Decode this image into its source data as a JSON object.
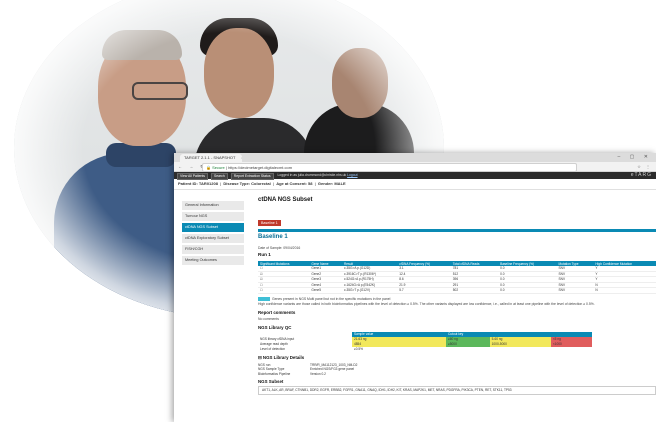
{
  "browser": {
    "tab_title": "TARGET 2.1.1 - SNAPSHOT",
    "tab_close": "×",
    "window_controls": "– ▢ ✕",
    "nav": "← → ↻",
    "secure_label": "Secure",
    "url": "https://decimetarget.digitalecmt.com",
    "right_icons": "☆ ⋮"
  },
  "app_toolbar": {
    "buttons": [
      "View All Patients",
      "Search",
      "Report Extraction Status"
    ],
    "logged_in_text": "Logged in as",
    "user_email": "julia.drummond@christie.nhs.uk",
    "logout": "Logout",
    "brand": "eTARG"
  },
  "patient": {
    "id_label": "Patient ID: TAR01208",
    "disease": "Disease Type: Colorectal",
    "age": "Age at Consent: 58",
    "gender": "Gender: MALE"
  },
  "sidebar": {
    "items": [
      {
        "label": "General Information"
      },
      {
        "label": "Tumour NGS"
      },
      {
        "label": "ctDNA NGS Subset"
      },
      {
        "label": "ctDNA Exploratory Subset"
      },
      {
        "label": "FISH/CGH"
      },
      {
        "label": "Meeting Outcomes"
      }
    ]
  },
  "main": {
    "title": "ctDNA NGS Subset",
    "baseline_badge": "Baseline 1",
    "baseline_heading": "Baseline 1",
    "date_of_sample": "Date of Sample: 09/04/2016",
    "run": "Run 1",
    "mutation_table": {
      "headers": [
        "Significant Mutations",
        "Gene Name",
        "Result",
        "cfDNA Frequency (%)",
        "Total cfDNA Reads",
        "Baseline Frequency (%)",
        "Mutation Type",
        "High Confidence Mutation"
      ],
      "rows": [
        [
          "☐",
          "Gene1",
          "c.35G>A p.(G12D)",
          "3.1",
          "781",
          "0.0",
          "SNV",
          "Y"
        ],
        [
          "☑",
          "Gene2",
          "c.3916C>T p.(R1306*)",
          "12.4",
          "512",
          "0.0",
          "SNV",
          "Y"
        ],
        [
          "☑",
          "Gene3",
          "c.524G>A p.(R175H)",
          "8.6",
          "396",
          "0.0",
          "SNV",
          "Y"
        ],
        [
          "☐",
          "Gene4",
          "c.1624G>A p.(E542K)",
          "21.9",
          "291",
          "0.0",
          "SNV",
          "N"
        ],
        [
          "☐",
          "Gene5",
          "c.35G>T p.(G12V)",
          "5.7",
          "502",
          "0.0",
          "SNV",
          "N"
        ]
      ]
    },
    "legend_text": "Genes present in NGS Multi panel but not in the specific mutations in the panel",
    "confidence_note": "High confidence variants are those called in both bioinformatics pipelines with the level of detection ≥ 0.5%. The other variants displayed are low confidence, i.e., called in at least one pipeline with the level of detection ≥ 0.5%.",
    "report_comments_title": "Report comments",
    "report_comments": "No comments",
    "qc_title": "NGS Library QC",
    "qc_table": {
      "headers": [
        "",
        "Sample value",
        "Cutout key"
      ],
      "rows": [
        {
          "label": "NGS library cfDNA input",
          "value": "21.63 ng",
          "k1": "≥60 ng",
          "k2": "5-60 ng",
          "k3": "<5 ng"
        },
        {
          "label": "Average read depth",
          "value": "4854",
          "k1": "≥5000",
          "k2": "1000-5000",
          "k3": "<1000"
        },
        {
          "label": "Level of detection",
          "value": "≥0.5%",
          "k1": "",
          "k2": "",
          "k3": ""
        }
      ]
    },
    "library_details_title": "⊟ NGS Library Details",
    "library_details": [
      {
        "k": "NGS run",
        "v": "TRR/R_MA112123_1003_NM-D2"
      },
      {
        "k": "NGS Sample Type",
        "v": "Enriched NGS/FG3 gene panel"
      },
      {
        "k": "Bioinformatics Pipeline",
        "v": "Version 0.2"
      }
    ],
    "subset_title": "NGS Subset",
    "subset_genes": "AKT1, ALK, AR, BRAF, CTNNB1, DDR2, EGFR, ERBB2, FGFR1, GNA11, GNAQ, IDH1, IDH2, KIT, KRAS, MAP2K1, MET, NRAS, PDGFRA, PIK3CA, PTEN, RET, STK11, TP53"
  },
  "colors": {
    "accent": "#0a8ab4",
    "badge": "#c0392b",
    "qc_green": "#5cb85c",
    "qc_yellow": "#f2e85c",
    "qc_red": "#e05d5d"
  }
}
